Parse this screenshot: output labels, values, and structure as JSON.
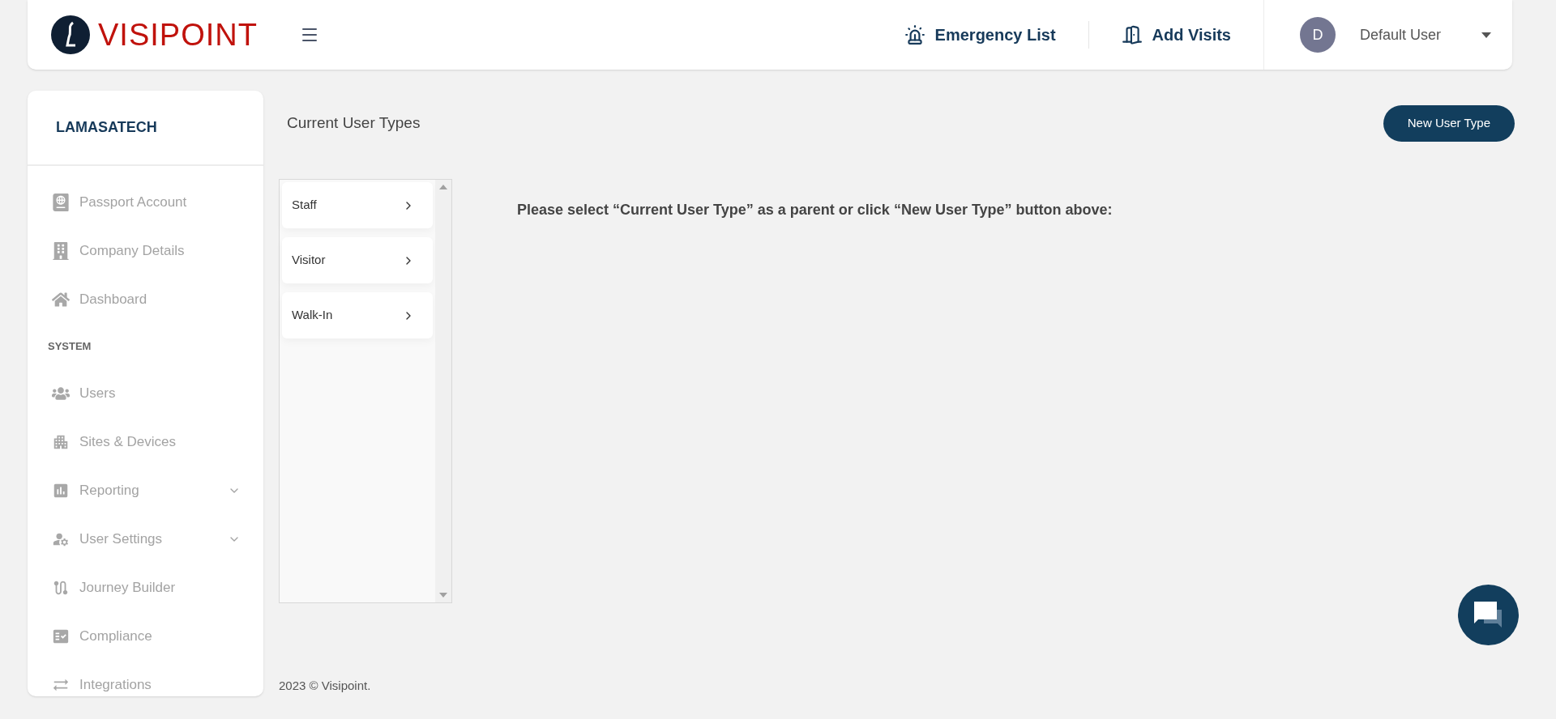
{
  "header": {
    "logo_text": "VISIPOINT",
    "actions": [
      {
        "label": "Emergency List",
        "kind": "emergency"
      },
      {
        "label": "Add Visits",
        "kind": "visits"
      }
    ],
    "user": {
      "initial": "D",
      "name": "Default User"
    }
  },
  "sidebar": {
    "company": "LAMASATECH",
    "items": [
      {
        "kind": "link",
        "label": "Passport Account"
      },
      {
        "kind": "link",
        "label": "Company Details"
      },
      {
        "kind": "link",
        "label": "Dashboard"
      },
      {
        "kind": "section",
        "label": "SYSTEM"
      },
      {
        "kind": "link",
        "label": "Users"
      },
      {
        "kind": "link",
        "label": "Sites & Devices"
      },
      {
        "kind": "group",
        "label": "Reporting",
        "expanded": false
      },
      {
        "kind": "group",
        "label": "User Settings",
        "expanded": false
      },
      {
        "kind": "link",
        "label": "Journey Builder"
      },
      {
        "kind": "link",
        "label": "Compliance"
      },
      {
        "kind": "link",
        "label": "Integrations"
      }
    ]
  },
  "page": {
    "title": "Current User Types",
    "new_button": "New User Type",
    "user_types": [
      "Staff",
      "Visitor",
      "Walk-In"
    ],
    "message": "Please select “Current User Type” as a parent or click “New User Type” button above:"
  },
  "footer": "2023 © Visipoint."
}
